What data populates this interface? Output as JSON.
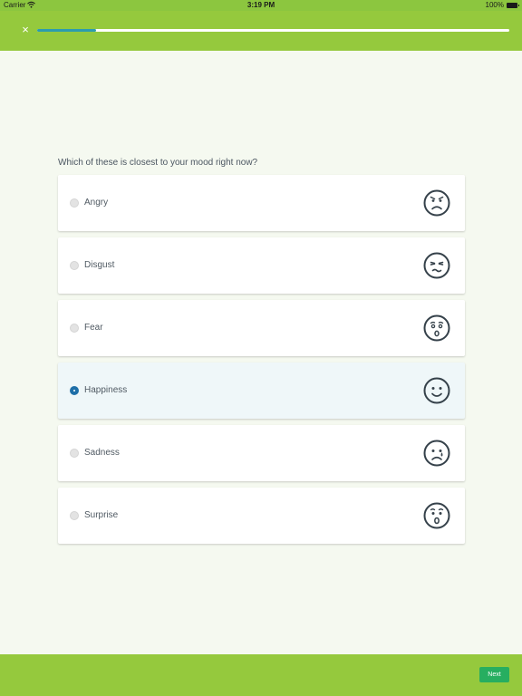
{
  "status_bar": {
    "carrier": "Carrier",
    "time": "3:19 PM",
    "battery": "100%"
  },
  "header": {
    "close_label": "×",
    "progress": 0.125,
    "progress_color": "#2c9cae"
  },
  "question": "Which of these is closest to your mood right now?",
  "options": [
    {
      "label": "Angry",
      "icon": "angry-face-icon",
      "selected": false
    },
    {
      "label": "Disgust",
      "icon": "disgust-face-icon",
      "selected": false
    },
    {
      "label": "Fear",
      "icon": "fear-face-icon",
      "selected": false
    },
    {
      "label": "Happiness",
      "icon": "happy-face-icon",
      "selected": true
    },
    {
      "label": "Sadness",
      "icon": "sad-face-icon",
      "selected": false
    },
    {
      "label": "Surprise",
      "icon": "surprise-face-icon",
      "selected": false
    }
  ],
  "footer": {
    "next_label": "Next"
  },
  "colors": {
    "header": "#95c93d",
    "accent": "#27ae60",
    "selected_radio": "#1e6fa8",
    "icon": "#35414a"
  }
}
